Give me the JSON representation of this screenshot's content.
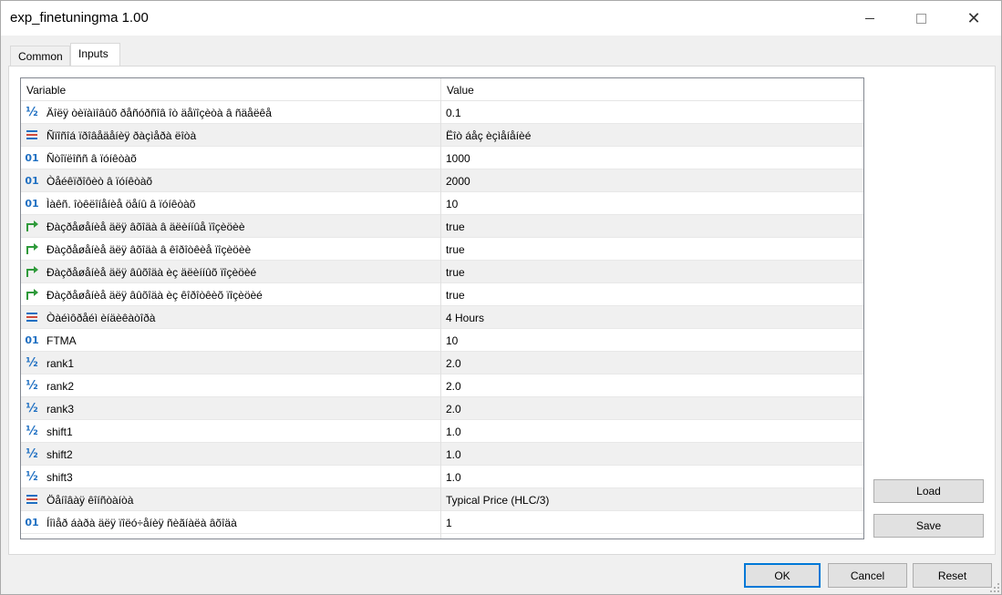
{
  "window": {
    "title": "exp_finetuningma 1.00",
    "close_glyph": "✕"
  },
  "tabs": [
    {
      "label": "Common"
    },
    {
      "label": "Inputs"
    }
  ],
  "grid": {
    "col_variable": "Variable",
    "col_value": "Value",
    "rows": [
      {
        "icon": "half-icon",
        "name": "Äîëÿ òèïàìîâûõ ðåñóðñîâ îò äåïîçèòà â ñäåëêå",
        "value": "0.1"
      },
      {
        "icon": "list-icon",
        "name": "Ñïîñîá ïðîâåäåíèÿ ðàçìåðà ëîòà",
        "value": "Ëîò áåç èçìåíåíèé"
      },
      {
        "icon": "int-icon",
        "name": "Ñòîïëîññ â ïóíêòàõ",
        "value": "1000"
      },
      {
        "icon": "int-icon",
        "name": "Òåéêïðîôèò â ïóíêòàõ",
        "value": "2000"
      },
      {
        "icon": "int-icon",
        "name": "Ìàêñ. îòêëîíåíèå öåíû â ïóíêòàõ",
        "value": "10"
      },
      {
        "icon": "bool-icon",
        "name": "Ðàçðåøåíèå äëÿ âõîäà â äëèííûå ïîçèöèè",
        "value": "true"
      },
      {
        "icon": "bool-icon",
        "name": "Ðàçðåøåíèå äëÿ âõîäà â êîðîòêèå ïîçèöèè",
        "value": "true"
      },
      {
        "icon": "bool-icon",
        "name": "Ðàçðåøåíèå äëÿ âûõîäà èç äëèííûõ ïîçèöèé",
        "value": "true"
      },
      {
        "icon": "bool-icon",
        "name": "Ðàçðåøåíèå äëÿ âûõîäà èç êîðîòêèõ ïîçèöèé",
        "value": "true"
      },
      {
        "icon": "list-icon",
        "name": "Òàéìôðåéì èíäèêàòîðà",
        "value": "4 Hours"
      },
      {
        "icon": "int-icon",
        "name": "FTMA",
        "value": "10"
      },
      {
        "icon": "half-icon",
        "name": "rank1",
        "value": "2.0"
      },
      {
        "icon": "half-icon",
        "name": "rank2",
        "value": "2.0"
      },
      {
        "icon": "half-icon",
        "name": "rank3",
        "value": "2.0"
      },
      {
        "icon": "half-icon",
        "name": "shift1",
        "value": "1.0"
      },
      {
        "icon": "half-icon",
        "name": "shift2",
        "value": "1.0"
      },
      {
        "icon": "half-icon",
        "name": "shift3",
        "value": "1.0"
      },
      {
        "icon": "list-icon",
        "name": "Öåíîâàÿ êîíñòàíòà",
        "value": "Typical Price (HLC/3)"
      },
      {
        "icon": "int-icon",
        "name": "Íîìåð áàðà äëÿ ïîëó÷åíèÿ ñèãíàëà âõîäà",
        "value": "1"
      }
    ]
  },
  "side_buttons": {
    "load": "Load",
    "save": "Save"
  },
  "footer_buttons": {
    "ok": "OK",
    "cancel": "Cancel",
    "reset": "Reset"
  },
  "colors": {
    "accent": "#0078d7",
    "icon_blue": "#1e6fc2",
    "icon_green": "#2e9a3a",
    "icon_red": "#d04a3a"
  }
}
